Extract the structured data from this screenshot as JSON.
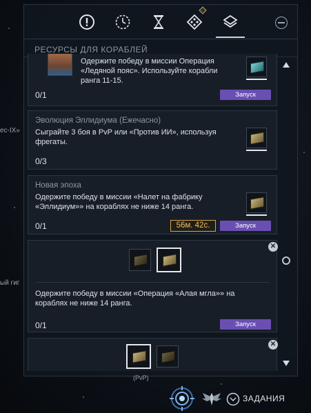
{
  "background": {
    "labels": [
      "ес-IX»",
      "ый гиг"
    ]
  },
  "tabs": [
    {
      "name": "alert-tab",
      "icon": "exclamation-circle-icon"
    },
    {
      "name": "clock-tab",
      "icon": "clock-icon"
    },
    {
      "name": "hourglass-tab",
      "icon": "hourglass-icon"
    },
    {
      "name": "dice-tab",
      "icon": "dice-diamond-icon"
    },
    {
      "name": "layers-tab",
      "icon": "layers-icon",
      "active": true
    }
  ],
  "section_title": "РЕСУРСЫ ДЛЯ КОРАБЛЕЙ",
  "missions": [
    {
      "desc": "Одержите победу в миссии Операция «Ледяной пояс». Используйте корабли ранга 11-15.",
      "progress": "0/1",
      "launch": "Запуск",
      "reward": "teal-crate-icon"
    },
    {
      "title": "Эволюция Эллидиума (Ежечасно)",
      "desc": "Сыграйте 3 боя в PvP или «Против ИИ», используя фрегаты.",
      "progress": "0/3",
      "reward": "gold-crate-icon"
    },
    {
      "title": "Новая эпоха",
      "desc": "Одержите победу в миссии «Налет на фабрику «Эллидиум»» на кораблях не ниже 14 ранга.",
      "progress": "0/1",
      "timer": "56м. 42с.",
      "launch": "Запуск",
      "reward": "gold-crate-icon"
    },
    {
      "desc": "Одержите победу в миссии «Операция «Алая мгла»» на кораблях не ниже 14 ранга.",
      "progress": "0/1",
      "launch": "Запуск",
      "choices": [
        "dark-crate-icon",
        "gold-crate-icon"
      ],
      "selected_choice": 1
    },
    {
      "choices": [
        "gold-crate-icon",
        "dark-crate-icon"
      ],
      "selected_choice": 0,
      "choice_label": "(PvP)"
    }
  ],
  "close_label": "✕",
  "bottom_bar": {
    "label": "ЗАДАНИЯ"
  },
  "colors": {
    "accent": "#6a4fb3",
    "timer": "#f0c063",
    "panel": "#10161e"
  }
}
